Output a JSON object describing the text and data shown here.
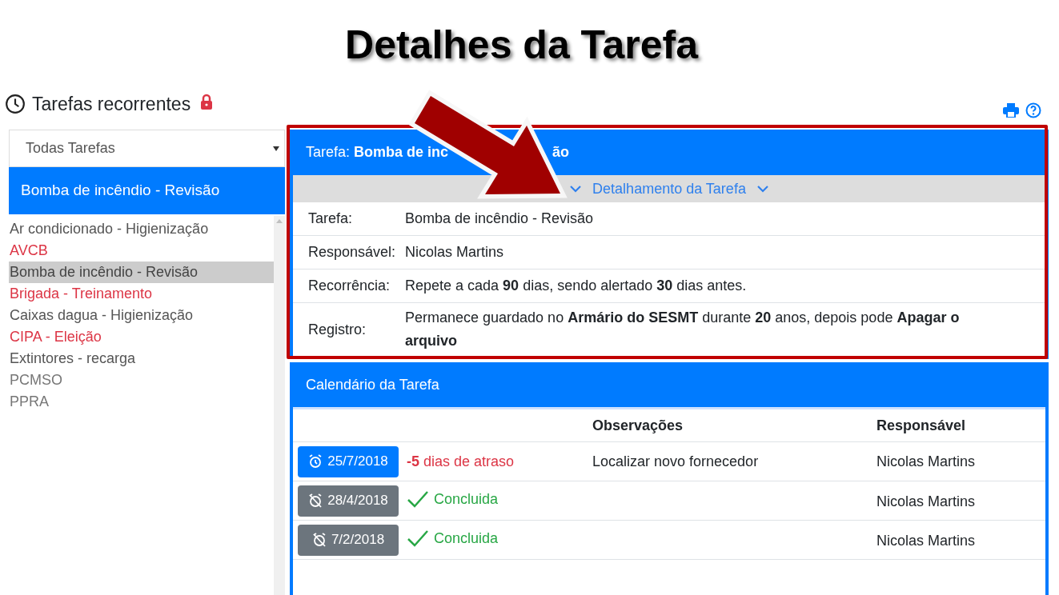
{
  "slide_title": "Detalhes da Tarefa",
  "page": {
    "title": "Tarefas recorrentes",
    "locked": true
  },
  "filter": {
    "value": "Todas Tarefas"
  },
  "current_task": "Bomba de incêndio - Revisão",
  "task_list": [
    {
      "label": "Ar condicionado - Higienização",
      "color": "#555555",
      "selected": false
    },
    {
      "label": "AVCB",
      "color": "#dc3545",
      "selected": false
    },
    {
      "label": "Bomba de incêndio - Revisão",
      "color": "#444444",
      "selected": true
    },
    {
      "label": "Brigada - Treinamento",
      "color": "#dc3545",
      "selected": false
    },
    {
      "label": "Caixas dagua - Higienização",
      "color": "#555555",
      "selected": false
    },
    {
      "label": "CIPA - Eleição",
      "color": "#dc3545",
      "selected": false
    },
    {
      "label": "Extintores - recarga",
      "color": "#555555",
      "selected": false
    },
    {
      "label": "PCMSO",
      "color": "#777777",
      "selected": false
    },
    {
      "label": "PPRA",
      "color": "#777777",
      "selected": false
    }
  ],
  "details": {
    "header_label": "Tarefa:",
    "header_visible_start": "Bomba de inc",
    "header_visible_end": "ão",
    "toggle": "Detalhamento da Tarefa",
    "expanded": true,
    "rows": [
      {
        "label": "Tarefa:",
        "value": "Bomba de incêndio - Revisão"
      },
      {
        "label": "Responsável:",
        "value": "Nicolas Martins"
      },
      {
        "label": "Recorrência:",
        "value": "Repete a cada **90** dias, sendo alertado **30** dias antes."
      },
      {
        "label": "Registro:",
        "value": "Permanece guardado no **Armário do SESMT** durante **20** anos, depois pode **Apagar o arquivo**"
      }
    ]
  },
  "calendar": {
    "title": "Calendário da Tarefa",
    "columns": [
      "Observações",
      "Responsável"
    ],
    "rows": [
      {
        "kind": "overdue",
        "date": "25/7/2018",
        "status": "**-5** dias de atraso",
        "note": "Localizar novo fornecedor",
        "owner": "Nicolas Martins"
      },
      {
        "kind": "done",
        "date": "28/4/2018",
        "status": "Concluida",
        "owner": "Nicolas Martins"
      },
      {
        "kind": "done",
        "date": "7/2/2018",
        "status": "Concluida",
        "owner": "Nicolas Martins"
      }
    ]
  }
}
